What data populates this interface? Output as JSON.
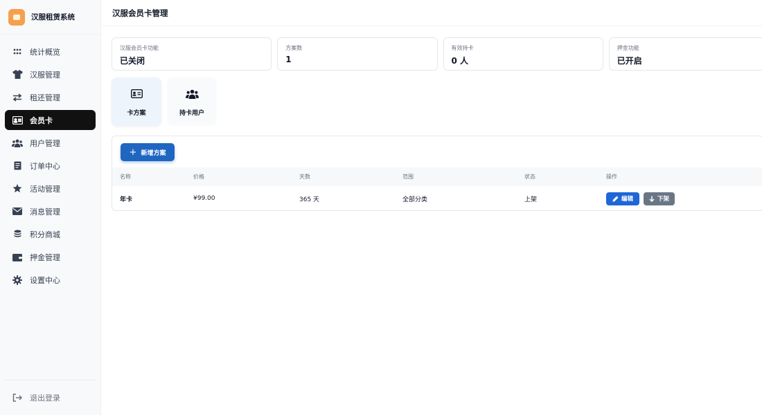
{
  "brand": {
    "title": "汉服租赁系统",
    "logo_color": "#f6a04d"
  },
  "sidebar": {
    "items": [
      {
        "label": "统计概览",
        "icon": "grid-dots-icon",
        "active": false
      },
      {
        "label": "汉服管理",
        "icon": "shirt-icon",
        "active": false
      },
      {
        "label": "租还管理",
        "icon": "swap-arrows-icon",
        "active": false
      },
      {
        "label": "会员卡",
        "icon": "id-card-icon",
        "active": true
      },
      {
        "label": "用户管理",
        "icon": "users-icon",
        "active": false
      },
      {
        "label": "订单中心",
        "icon": "receipt-icon",
        "active": false
      },
      {
        "label": "活动管理",
        "icon": "star-icon",
        "active": false
      },
      {
        "label": "消息管理",
        "icon": "envelope-icon",
        "active": false
      },
      {
        "label": "积分商城",
        "icon": "coins-icon",
        "active": false
      },
      {
        "label": "押金管理",
        "icon": "wallet-icon",
        "active": false
      },
      {
        "label": "设置中心",
        "icon": "gear-icon",
        "active": false
      }
    ],
    "logout_label": "退出登录"
  },
  "header": {
    "title": "汉服会员卡管理"
  },
  "stats": [
    {
      "label": "汉服会员卡功能",
      "value": "已关闭"
    },
    {
      "label": "方案数",
      "value": "1"
    },
    {
      "label": "有效持卡",
      "value": "0 人"
    },
    {
      "label": "押金功能",
      "value": "已开启"
    }
  ],
  "tabs": [
    {
      "label": "卡方案",
      "icon": "id-card-icon",
      "active": true
    },
    {
      "label": "持卡用户",
      "icon": "users-icon",
      "active": false
    }
  ],
  "panel": {
    "add_button_label": "新增方案",
    "columns": [
      "名称",
      "价格",
      "天数",
      "范围",
      "状态",
      "操作"
    ],
    "rows": [
      {
        "name": "年卡",
        "price": "¥99.00",
        "days": "365 天",
        "scope": "全部分类",
        "status": "上架",
        "edit_label": "编辑",
        "offshelf_label": "下架"
      }
    ]
  },
  "colors": {
    "primary": "#1f66c1",
    "active_nav": "#111111",
    "secondary_button": "#6b7685"
  }
}
